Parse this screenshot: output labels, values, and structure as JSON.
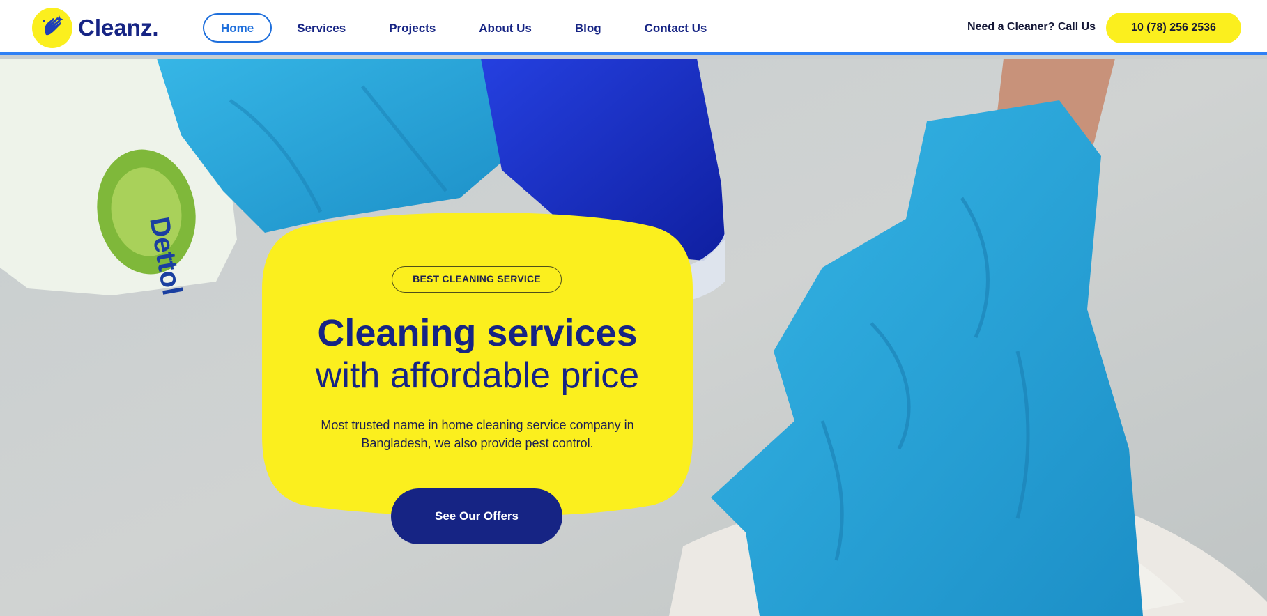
{
  "brand": {
    "name": "Cleanz.",
    "logo_icon": "hand-sparkle-icon"
  },
  "nav": {
    "items": [
      {
        "label": "Home",
        "active": true
      },
      {
        "label": "Services",
        "active": false
      },
      {
        "label": "Projects",
        "active": false
      },
      {
        "label": "About Us",
        "active": false
      },
      {
        "label": "Blog",
        "active": false
      },
      {
        "label": "Contact Us",
        "active": false
      }
    ]
  },
  "header": {
    "call_text": "Need a Cleaner? Call Us",
    "phone": "10 (78) 256 2536"
  },
  "hero": {
    "badge": "BEST CLEANING SERVICE",
    "headline_bold": "Cleaning services",
    "headline_light": "with affordable price",
    "description": "Most trusted name in home cleaning service company in Bangladesh, we also provide pest control.",
    "cta_label": "See Our Offers",
    "bottle_label": "Dettol"
  },
  "colors": {
    "navy": "#162484",
    "yellow": "#fbef1e",
    "accent_blue": "#2f80f5",
    "glove_blue": "#2aa8d8"
  }
}
